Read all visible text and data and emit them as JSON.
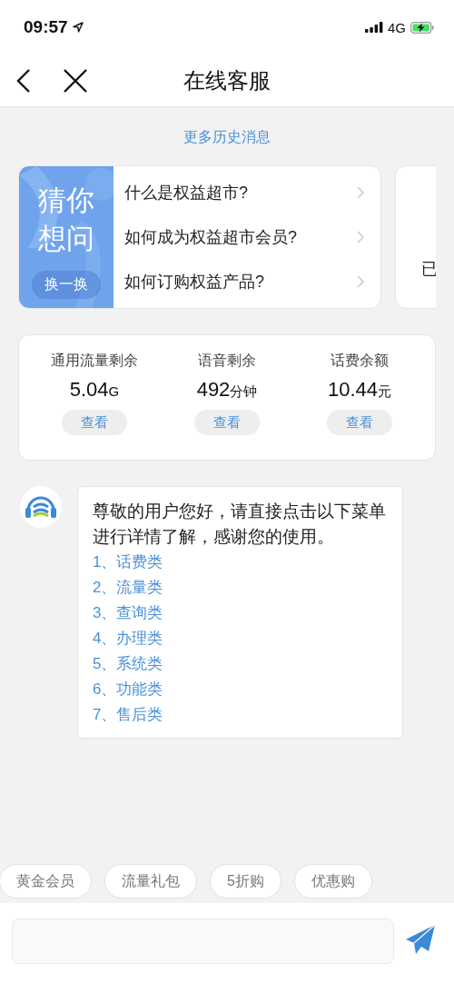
{
  "status_bar": {
    "time": "09:57",
    "network": "4G"
  },
  "nav": {
    "title": "在线客服"
  },
  "history_link": "更多历史消息",
  "guess_card": {
    "title": "猜你想问",
    "refresh": "换一换",
    "questions": [
      "什么是权益超市?",
      "如何成为权益超市会员?",
      "如何订购权益产品?"
    ]
  },
  "next_card": {
    "text": "已"
  },
  "balance_card": {
    "items": [
      {
        "label": "通用流量剩余",
        "value": "5.04",
        "unit": "G",
        "button": "查看"
      },
      {
        "label": "语音剩余",
        "value": "492",
        "unit": "分钟",
        "button": "查看"
      },
      {
        "label": "话费余额",
        "value": "10.44",
        "unit": "元",
        "button": "查看"
      }
    ]
  },
  "message": {
    "text": "尊敬的用户您好，请直接点击以下菜单进行详情了解，感谢您的使用。",
    "menu": [
      "1、话费类",
      "2、流量类",
      "3、查询类",
      "4、办理类",
      "5、系统类",
      "6、功能类",
      "7、售后类"
    ]
  },
  "quick_chips": [
    "黄金会员",
    "流量礼包",
    "5折购",
    "优惠购"
  ]
}
